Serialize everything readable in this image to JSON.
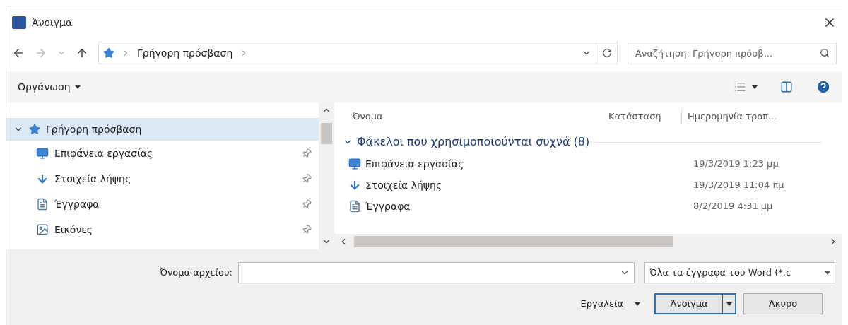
{
  "window": {
    "title": "Άνοιγμα"
  },
  "address": {
    "segments": [
      "Γρήγορη πρόσβαση"
    ]
  },
  "search": {
    "placeholder": "Αναζήτηση: Γρήγορη πρόσβ..."
  },
  "toolbar": {
    "organize": "Οργάνωση"
  },
  "sidebar": {
    "items": [
      {
        "label": "Γρήγορη πρόσβαση",
        "kind": "quick",
        "selected": true,
        "expanded": true,
        "children": [
          {
            "label": "Επιφάνεια εργασίας",
            "kind": "desktop",
            "selected": false,
            "pinned": true
          },
          {
            "label": "Στοιχεία λήψης",
            "kind": "downloads",
            "selected": false,
            "pinned": true
          },
          {
            "label": "Έγγραφα",
            "kind": "documents",
            "selected": false,
            "pinned": true
          },
          {
            "label": "Εικόνες",
            "kind": "pictures",
            "selected": false,
            "pinned": true
          }
        ]
      }
    ]
  },
  "table": {
    "columns": [
      "Όνομα",
      "Κατάσταση",
      "Ημερομηνία τροπ..."
    ],
    "group": {
      "label": "Φάκελοι που χρησιμοποιούνται συχνά (8)",
      "expanded": true
    },
    "rows": [
      {
        "name": "Επιφάνεια εργασίας",
        "kind": "desktop",
        "date": "19/3/2019 1:23 μμ"
      },
      {
        "name": "Στοιχεία λήψης",
        "kind": "downloads",
        "date": "19/3/2019 11:04 πμ"
      },
      {
        "name": "Έγγραφα",
        "kind": "documents",
        "date": "8/2/2019 4:31 μμ"
      }
    ]
  },
  "footer": {
    "filename_label": "Όνομα αρχείου:",
    "filetype": "Όλα τα έγγραφα του Word (*.c",
    "tools": "Εργαλεία",
    "open": "Άνοιγμα",
    "cancel": "Άκυρο"
  }
}
